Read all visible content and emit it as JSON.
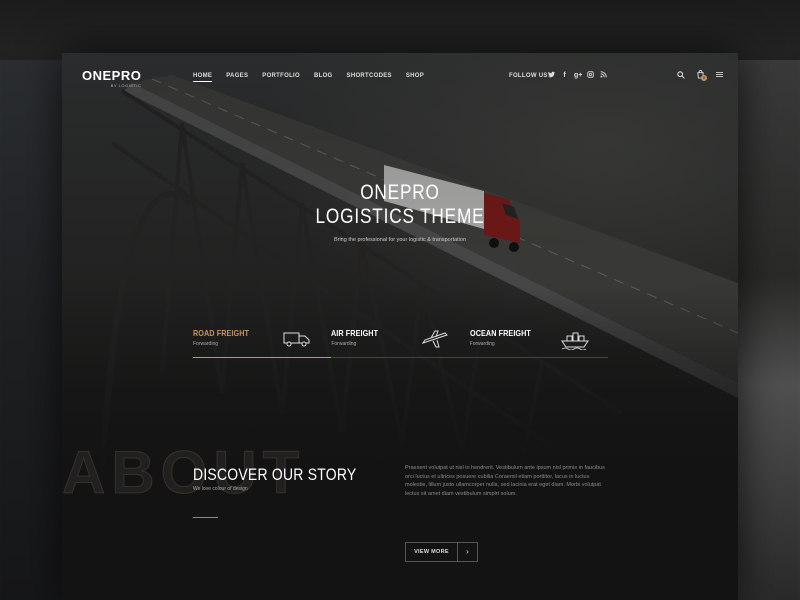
{
  "brand": {
    "name": "ONEPRO",
    "tagline": "BY LOGISTIC"
  },
  "nav": {
    "items": [
      "HOME",
      "PAGES",
      "PORTFOLIO",
      "BLOG",
      "SHORTCODES",
      "SHOP"
    ],
    "active": "HOME",
    "follow_label": "FOLLOW US",
    "social": [
      {
        "icon": "twitter-icon",
        "glyph": "ᵛ"
      },
      {
        "icon": "facebook-icon",
        "glyph": "f"
      },
      {
        "icon": "google-plus-icon",
        "glyph": "g+"
      },
      {
        "icon": "instagram-icon",
        "glyph": "▣"
      },
      {
        "icon": "rss-icon",
        "glyph": "◔"
      }
    ],
    "cart_count": "0"
  },
  "hero": {
    "title_line1": "ONEPRO",
    "title_line2": "LOGISTICS THEME",
    "subtitle": "Bring the professional for your logistic & transportation"
  },
  "services": [
    {
      "title": "ROAD FREIGHT",
      "subtitle": "Forwarding",
      "icon": "truck-icon",
      "active": true
    },
    {
      "title": "AIR FREIGHT",
      "subtitle": "Forwarding",
      "icon": "airplane-icon",
      "active": false
    },
    {
      "title": "OCEAN FREIGHT",
      "subtitle": "Forwarding",
      "icon": "ship-icon",
      "active": false
    }
  ],
  "about": {
    "watermark": "ABOUT",
    "title": "DISCOVER OUR STORY",
    "tagline": "We love colour of design",
    "paragraph": "Praesent volutpat ut nisl in hendrerit. Vestibulum ante ipsum nisl primis in faucibus orci luctus et ultrices posuere cubilia Coraemil etiam porttitor, lacus in luctus molestie, lillum justo ullamcorper nulla, sed lacinia erat eget diam. Morbi volutpat lectus sit amet diam vestibulum simplrt solum.",
    "button_label": "VIEW MORE",
    "button_arrow": "›"
  },
  "colors": {
    "accent": "#c6955e",
    "background": "#131313"
  }
}
